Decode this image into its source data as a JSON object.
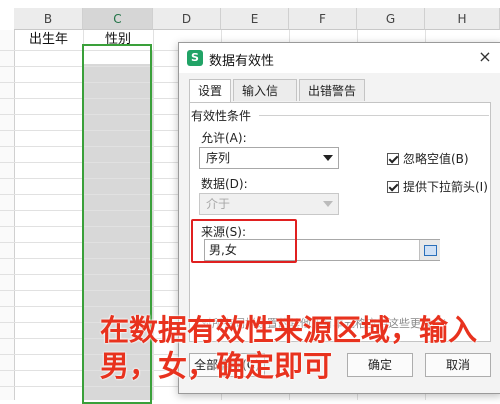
{
  "sheet": {
    "columns": [
      "B",
      "C",
      "D",
      "E",
      "F",
      "G",
      "H"
    ],
    "headers": {
      "b1": "出生年",
      "c1": "性别"
    }
  },
  "dialog": {
    "title": "数据有效性",
    "close_icon": "×",
    "tabs": [
      "设置",
      "输入信息",
      "出错警告"
    ],
    "group_label": "有效性条件",
    "allow_label": "允许(A):",
    "allow_value": "序列",
    "data_label": "数据(D):",
    "data_value": "介于",
    "ignore_blank_label": "忽略空值(B)",
    "dropdown_arrow_label": "提供下拉箭头(I)",
    "source_label": "来源(S):",
    "source_value": "男,女",
    "note_text": "对所有同样设置的其他所有单元格应用这些更改(P)",
    "clear_button": "全部清除(C)",
    "ok_button": "确定",
    "cancel_button": "取消"
  },
  "caption": "在数据有效性来源区域，输入\n男，女，确定即可",
  "colors": {
    "accent_green": "#3aa03a",
    "highlight_red": "#e02020",
    "caption_red": "#e8321e"
  }
}
